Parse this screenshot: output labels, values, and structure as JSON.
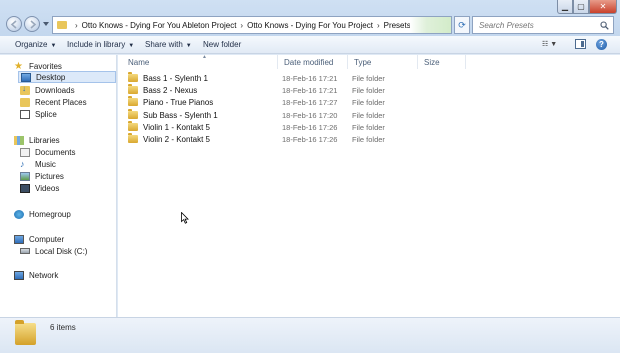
{
  "address": {
    "crumbs": [
      "Otto Knows - Dying For You Ableton Project",
      "Otto Knows - Dying For You Project",
      "Presets"
    ],
    "search_placeholder": "Search Presets"
  },
  "toolbar": {
    "organize": "Organize",
    "include_in_library": "Include in library",
    "share_with": "Share with",
    "new_folder": "New folder"
  },
  "sidebar": {
    "favorites_label": "Favorites",
    "favorites": [
      "Desktop",
      "Downloads",
      "Recent Places",
      "Splice"
    ],
    "libraries_label": "Libraries",
    "libraries": [
      "Documents",
      "Music",
      "Pictures",
      "Videos"
    ],
    "homegroup_label": "Homegroup",
    "computer_label": "Computer",
    "computer": [
      "Local Disk (C:)"
    ],
    "network_label": "Network"
  },
  "table": {
    "columns": [
      "Name",
      "Date modified",
      "Type",
      "Size"
    ],
    "rows": [
      {
        "name": "Bass 1 - Sylenth 1",
        "date": "18-Feb-16 17:21",
        "type": "File folder"
      },
      {
        "name": "Bass 2 - Nexus",
        "date": "18-Feb-16 17:21",
        "type": "File folder"
      },
      {
        "name": "Piano - True Pianos",
        "date": "18-Feb-16 17:27",
        "type": "File folder"
      },
      {
        "name": "Sub Bass - Sylenth 1",
        "date": "18-Feb-16 17:20",
        "type": "File folder"
      },
      {
        "name": "Violin 1 - Kontakt 5",
        "date": "18-Feb-16 17:26",
        "type": "File folder"
      },
      {
        "name": "Violin 2 - Kontakt 5",
        "date": "18-Feb-16 17:26",
        "type": "File folder"
      }
    ]
  },
  "status": {
    "item_count": "6 items"
  }
}
